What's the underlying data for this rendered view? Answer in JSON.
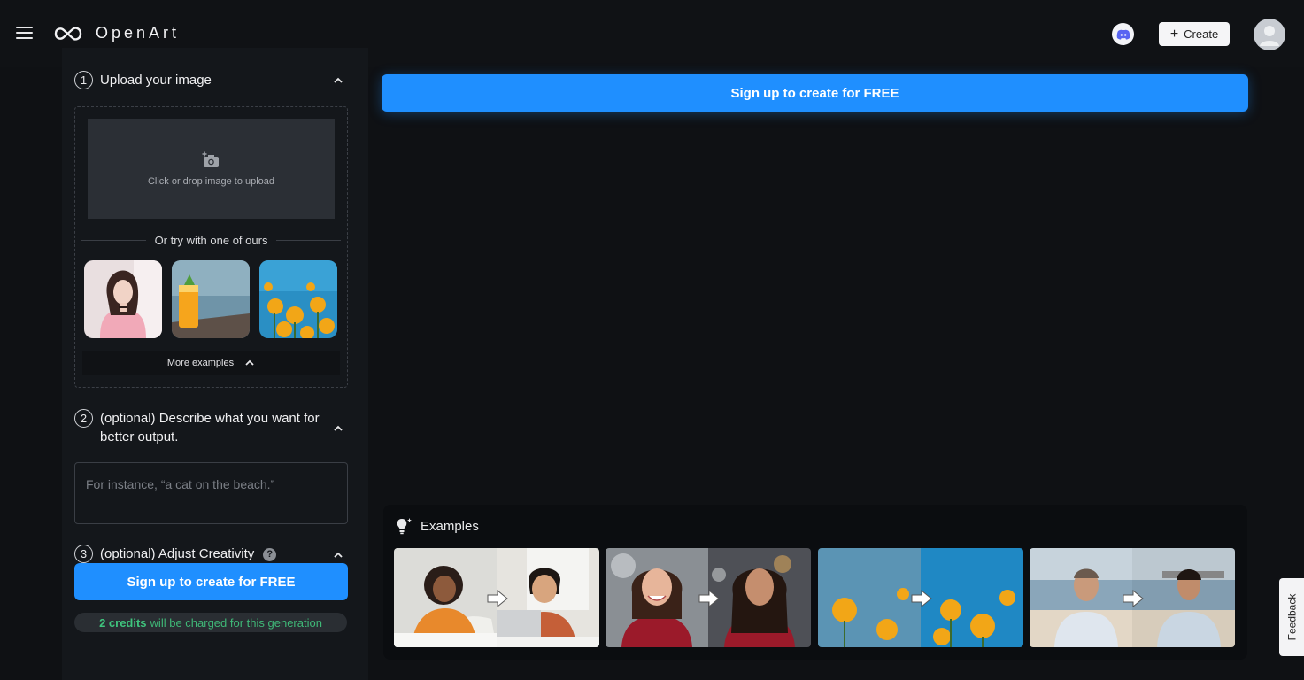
{
  "header": {
    "brand": "OpenArt",
    "create_label": "Create",
    "menu_icon": "hamburger-icon",
    "discord_icon": "discord-icon"
  },
  "steps": {
    "upload": {
      "number": "1",
      "title": "Upload your image",
      "dropzone_hint": "Click or drop image to upload",
      "or_text": "Or try with one of ours",
      "more_examples": "More examples"
    },
    "describe": {
      "number": "2",
      "title": "(optional) Describe what you want for better output.",
      "placeholder": "For instance, “a cat on the beach.”"
    },
    "creativity": {
      "number": "3",
      "title": "(optional) Adjust Creativity",
      "help_glyph": "?"
    }
  },
  "cta": {
    "signup_label": "Sign up to create for FREE"
  },
  "credits": {
    "amount": "2 credits",
    "suffix": "will be charged for this generation"
  },
  "examples": {
    "title": "Examples"
  },
  "feedback_label": "Feedback",
  "colors": {
    "accent": "#1f8fff",
    "credits_green": "#3fc47d",
    "background": "#0f1114",
    "panel": "#14171b"
  }
}
